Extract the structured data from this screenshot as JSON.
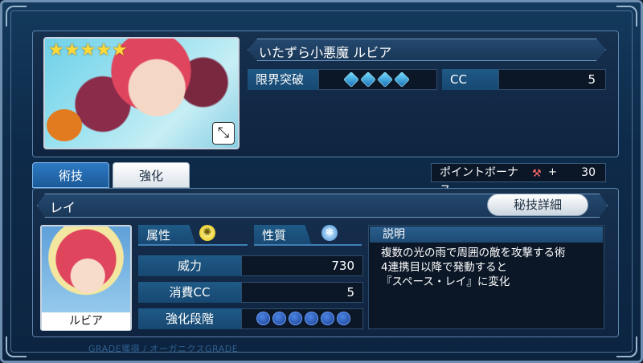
{
  "card": {
    "rarity_stars": "★★★★★",
    "name": "いたずら小悪魔 ルビア",
    "expand_icon": "expand-arrows-icon",
    "limit_break_label": "限界突破",
    "limit_break_gems": 4,
    "cc_label": "CC",
    "cc_value": "5"
  },
  "tabs": [
    {
      "label": "術技",
      "active": true
    },
    {
      "label": "強化",
      "active": false
    }
  ],
  "bonus": {
    "label": "ポイントボーナス",
    "plus": "+",
    "value": "30"
  },
  "skill": {
    "name": "レイ",
    "detail_button": "秘技詳細",
    "character_name": "ルビア",
    "attribute_label": "属性",
    "attribute_icon": "light-icon",
    "nature_label": "性質",
    "nature_icon": "ice-crystal-icon",
    "stats": [
      {
        "label": "威力",
        "value": "730"
      },
      {
        "label": "消費CC",
        "value": "5"
      },
      {
        "label": "強化段階",
        "value": ""
      }
    ],
    "enhance_pips": 6,
    "description_title": "説明",
    "description_lines": [
      "複数の光の雨で周囲の敵を攻撃する術",
      "4連携目以降で発動すると",
      "『スペース・レイ』に変化"
    ]
  },
  "footer_text": "GRADE獲得 / オーガニクスGRADE"
}
